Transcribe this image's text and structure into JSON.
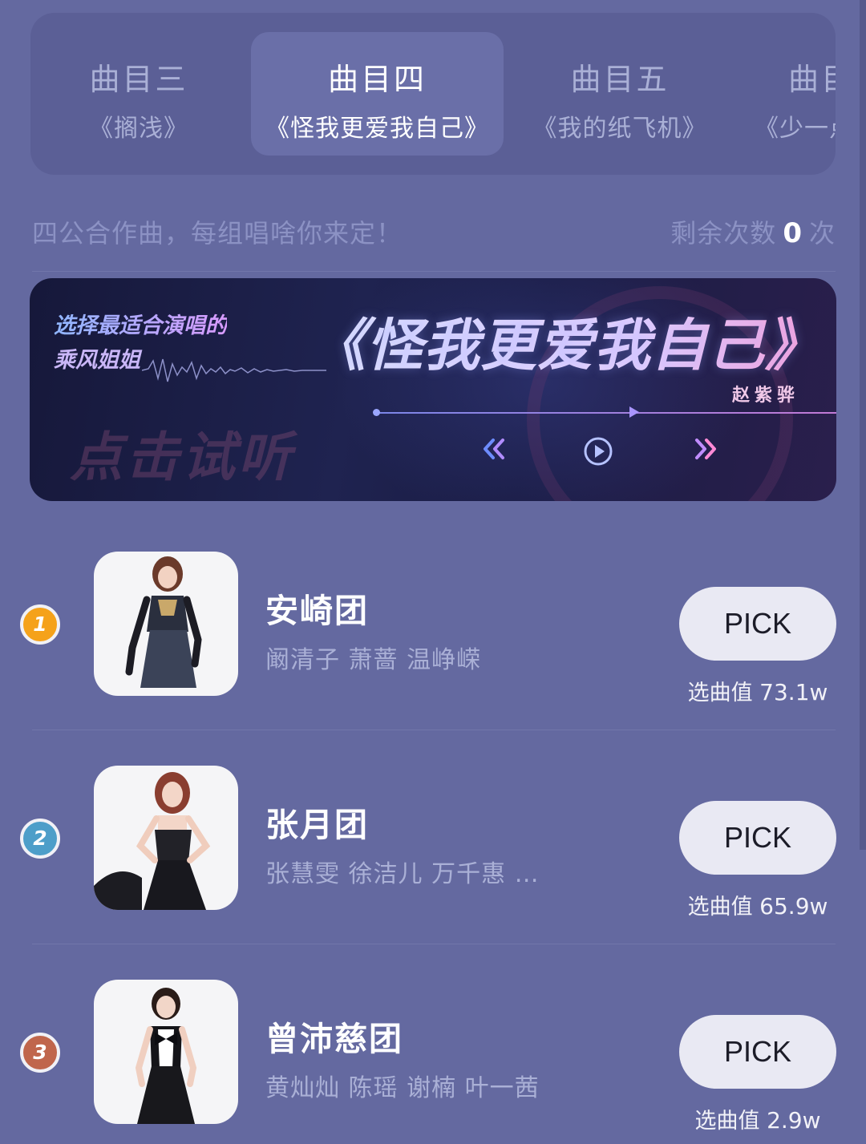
{
  "tabs": [
    {
      "num": "曲目三",
      "name": "《搁浅》",
      "active": false
    },
    {
      "num": "曲目四",
      "name": "《怪我更爱我自己》",
      "active": true
    },
    {
      "num": "曲目五",
      "name": "《我的纸飞机》",
      "active": false
    },
    {
      "num": "曲目",
      "name": "《少一点",
      "active": false
    }
  ],
  "info": {
    "tip": "四公合作曲，每组唱啥你来定！",
    "remain_prefix": "剩余次数",
    "remain_count": "0",
    "remain_suffix": "次"
  },
  "banner": {
    "slogan_line1": "选择最适合演唱的",
    "slogan_line2": "乘风姐姐",
    "hint": "点击试听",
    "title": "《怪我更爱我自己》",
    "singer": "赵紫骅",
    "controls": {
      "prev": "rewind-icon",
      "play": "play-icon",
      "next": "fast-forward-icon"
    }
  },
  "groups": [
    {
      "rank": "1",
      "rank_color": "#f5a21a",
      "name": "安崎团",
      "members": "阚清子 萧蔷 温峥嵘",
      "pick_label": "PICK",
      "votes_label": "选曲值",
      "votes_value": "73.1w"
    },
    {
      "rank": "2",
      "rank_color": "#4d9ec9",
      "name": "张月团",
      "members": "张慧雯 徐洁儿 万千惠 …",
      "pick_label": "PICK",
      "votes_label": "选曲值",
      "votes_value": "65.9w"
    },
    {
      "rank": "3",
      "rank_color": "#c0664c",
      "name": "曾沛慈团",
      "members": "黄灿灿 陈瑶 谢楠 叶一茜",
      "pick_label": "PICK",
      "votes_label": "选曲值",
      "votes_value": "2.9w"
    }
  ]
}
